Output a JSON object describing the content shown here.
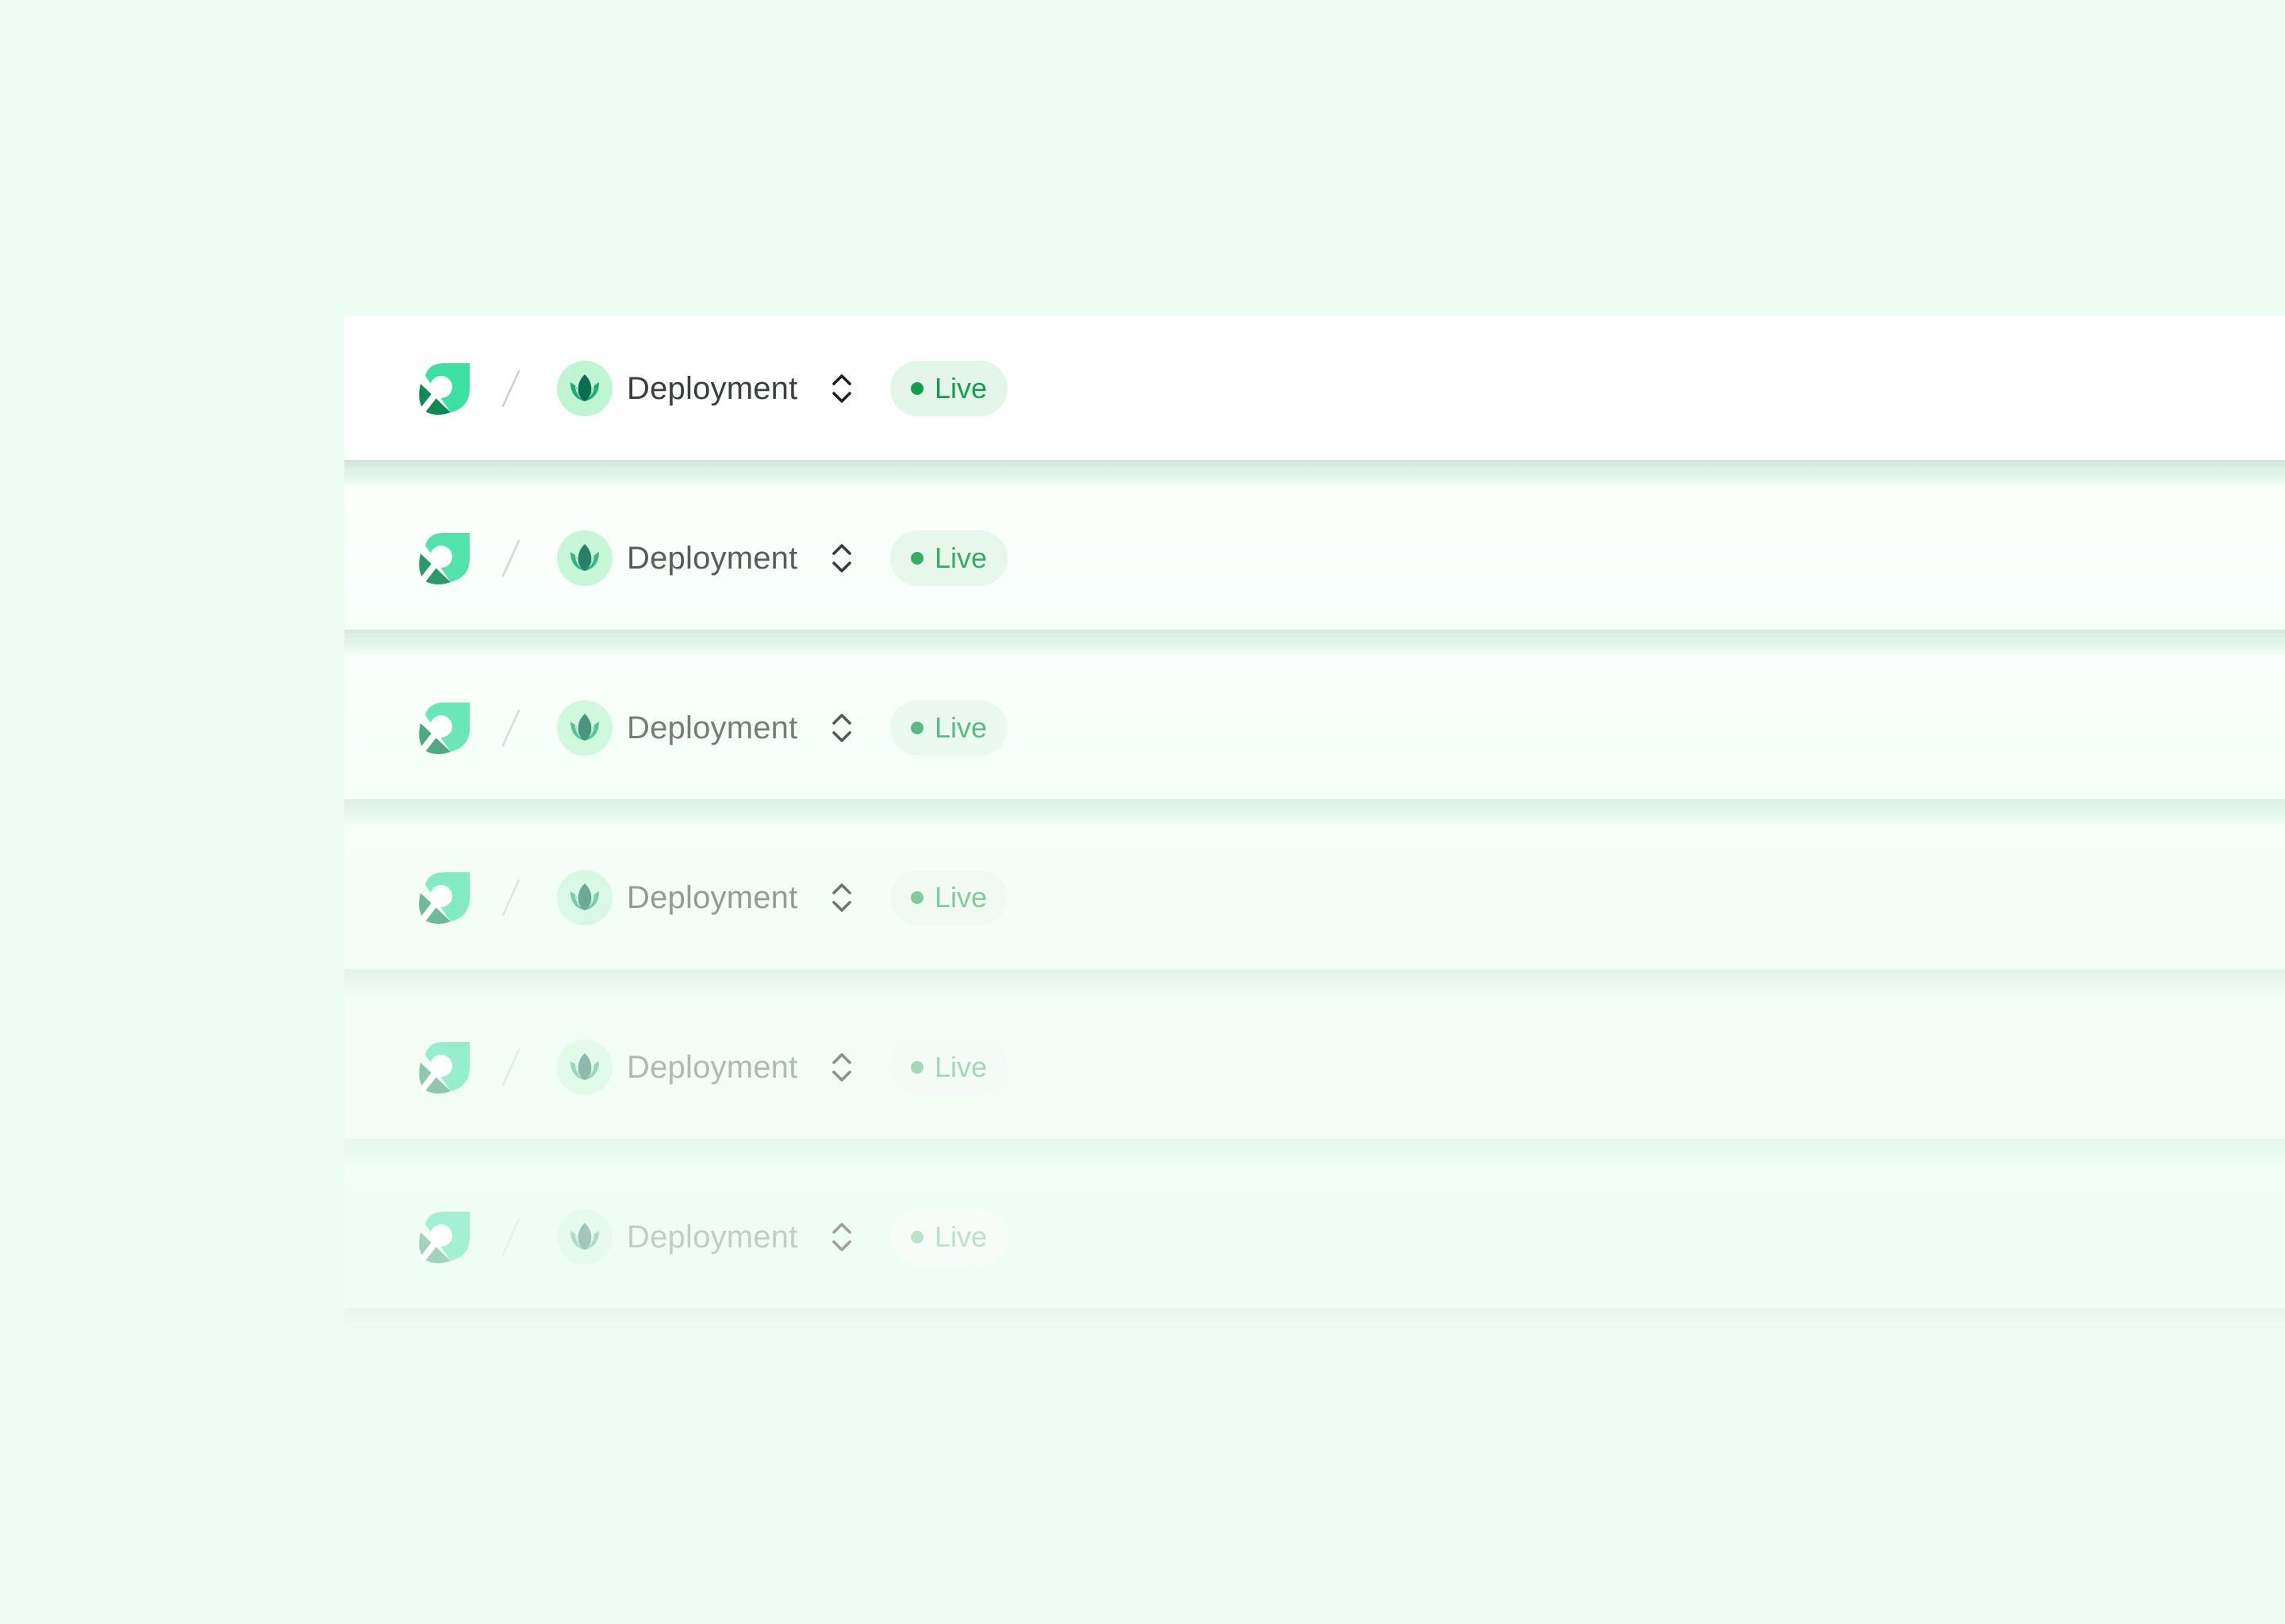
{
  "colors": {
    "page_background": "#eefdf3",
    "brand_dark": "#0f8a55",
    "brand_light": "#3de0a3",
    "avatar_bg": "#bff5d3",
    "status_green": "#149e4c",
    "pill_bg": "#e3f6e9"
  },
  "rows": [
    {
      "logo_icon": "leaf-magnifier-logo-icon",
      "separator": "/",
      "avatar_icon": "lotus-icon",
      "project_name": "Deployment",
      "switcher_icon": "chevron-up-down-icon",
      "status_label": "Live",
      "opacity": 1
    },
    {
      "logo_icon": "leaf-magnifier-logo-icon",
      "separator": "/",
      "avatar_icon": "lotus-icon",
      "project_name": "Deployment",
      "switcher_icon": "chevron-up-down-icon",
      "status_label": "Live",
      "opacity": 0.82
    },
    {
      "logo_icon": "leaf-magnifier-logo-icon",
      "separator": "/",
      "avatar_icon": "lotus-icon",
      "project_name": "Deployment",
      "switcher_icon": "chevron-up-down-icon",
      "status_label": "Live",
      "opacity": 0.62
    },
    {
      "logo_icon": "leaf-magnifier-logo-icon",
      "separator": "/",
      "avatar_icon": "lotus-icon",
      "project_name": "Deployment",
      "switcher_icon": "chevron-up-down-icon",
      "status_label": "Live",
      "opacity": 0.42
    },
    {
      "logo_icon": "leaf-magnifier-logo-icon",
      "separator": "/",
      "avatar_icon": "lotus-icon",
      "project_name": "Deployment",
      "switcher_icon": "chevron-up-down-icon",
      "status_label": "Live",
      "opacity": 0.24
    },
    {
      "logo_icon": "leaf-magnifier-logo-icon",
      "separator": "/",
      "avatar_icon": "lotus-icon",
      "project_name": "Deployment",
      "switcher_icon": "chevron-up-down-icon",
      "status_label": "Live",
      "opacity": 0.12
    }
  ]
}
